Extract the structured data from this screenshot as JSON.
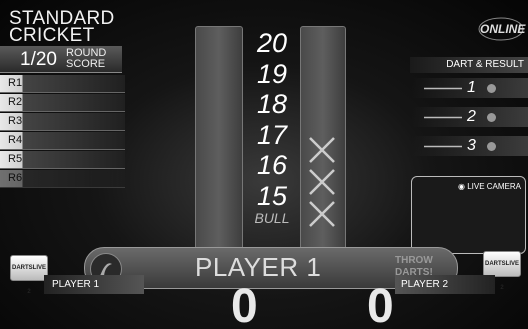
{
  "game": {
    "mode_line1": "STANDARD",
    "mode_line2": "CRICKET",
    "round_value": "1/20",
    "round_label1": "ROUND",
    "round_label2": "SCORE",
    "rounds": [
      "R1",
      "R2",
      "R3",
      "R4",
      "R5",
      "R6"
    ]
  },
  "board": {
    "numbers": [
      "20",
      "19",
      "18",
      "17",
      "16",
      "15",
      "BULL"
    ],
    "marked": [
      "17",
      "16",
      "15"
    ]
  },
  "logo": {
    "text": "ONLINE"
  },
  "dart_result": {
    "header": "DART & RESULT",
    "darts": [
      "1",
      "2",
      "3"
    ]
  },
  "camera": {
    "label": "LIVE CAMERA"
  },
  "banner": {
    "current_player": "PLAYER 1",
    "throw_line1": "THROW",
    "throw_line2": "DARTS!"
  },
  "players": [
    {
      "name": "PLAYER 1",
      "score": "0",
      "card": "DARTSLIVE 2"
    },
    {
      "name": "PLAYER 2",
      "score": "0",
      "card": "DARTSLIVE 2"
    }
  ]
}
